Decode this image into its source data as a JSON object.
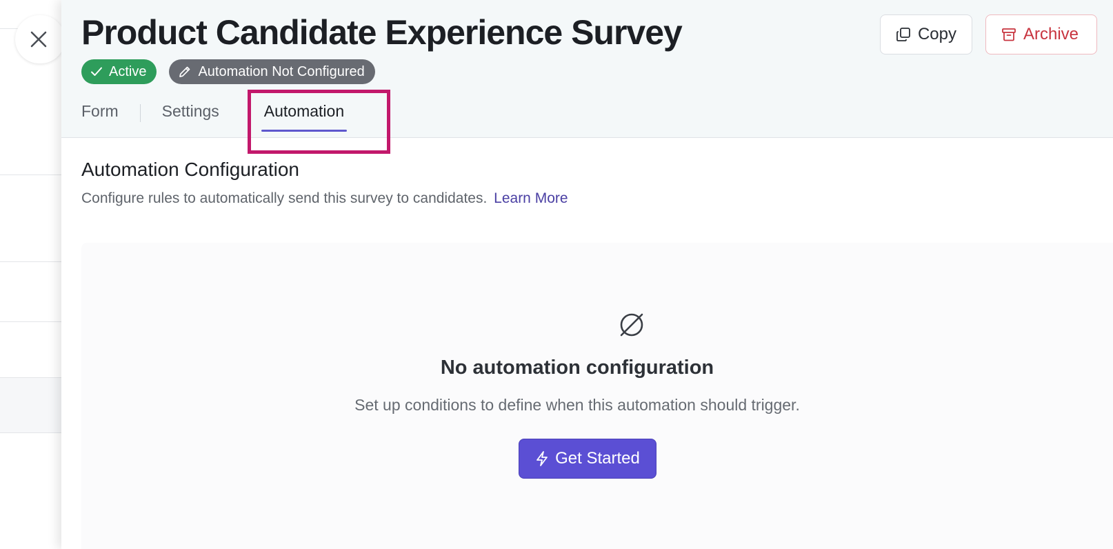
{
  "background_page": {},
  "drawer": {
    "title": "Product Candidate Experience Survey",
    "badges": {
      "status": "Active",
      "automation": "Automation Not Configured"
    },
    "actions": {
      "copy_label": "Copy",
      "archive_label": "Archive"
    },
    "tabs": [
      {
        "label": "Form",
        "active": false
      },
      {
        "label": "Settings",
        "active": false
      },
      {
        "label": "Automation",
        "active": true
      }
    ],
    "automation": {
      "heading": "Automation Configuration",
      "description": "Configure rules to automatically send this survey to candidates.",
      "learn_more": "Learn More",
      "empty_state": {
        "icon": "empty-set-icon",
        "title": "No automation configuration",
        "description": "Set up conditions to define when this automation should trigger.",
        "cta_label": "Get Started"
      }
    }
  },
  "colors": {
    "accent": "#5b4fd4",
    "active_badge": "#2e9d5b",
    "neutral_badge": "#686b72",
    "danger": "#c8343f",
    "highlight": "#c2186b"
  }
}
